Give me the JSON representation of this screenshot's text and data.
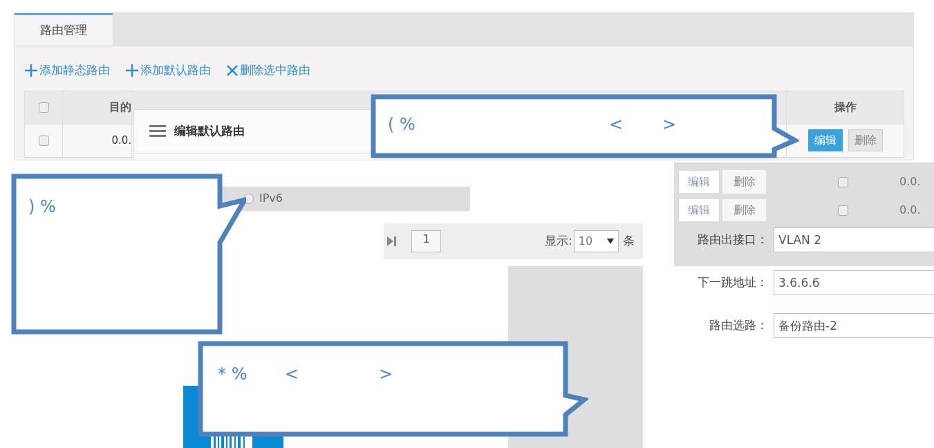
{
  "tabs": [
    {
      "label": "路由管理",
      "selected": true
    }
  ],
  "toolbar": [
    {
      "kind": "add",
      "label": "添加静态路由"
    },
    {
      "kind": "add",
      "label": "添加默认路由"
    },
    {
      "kind": "delete",
      "label": "删除选中路由"
    }
  ],
  "table": {
    "header_checked": false,
    "columns": [
      "目的",
      "操作"
    ],
    "rows": [
      {
        "checked": false,
        "cell": "0.0.",
        "actions": [
          {
            "kind": "primary",
            "label": "编辑"
          },
          {
            "kind": "default",
            "label": "删除"
          }
        ]
      }
    ]
  },
  "dialog": {
    "title": "编辑默认路由"
  },
  "callouts": [
    {
      "texts": [
        "( %",
        "<",
        ">"
      ]
    },
    {
      "texts": [
        ") %"
      ]
    },
    {
      "texts": [
        "* %",
        "<",
        ">"
      ]
    }
  ],
  "radio": {
    "label": "IPv6",
    "selected": false
  },
  "pagination": {
    "page": "1",
    "show_label": "显示:",
    "page_size": "10",
    "unit": "条"
  },
  "ghost_rows": [
    {
      "checked": false,
      "cell": "0.0.",
      "actions": [
        "编辑",
        "删除"
      ]
    },
    {
      "checked": false,
      "cell": "0.0.",
      "actions": [
        "编辑",
        "删除"
      ]
    }
  ],
  "form": [
    {
      "label": "路由出接口：",
      "value": "VLAN 2"
    },
    {
      "label": "下一跳地址：",
      "value": "3.6.6.6"
    },
    {
      "label": "路由选路：",
      "value": "备份路由-2"
    }
  ]
}
